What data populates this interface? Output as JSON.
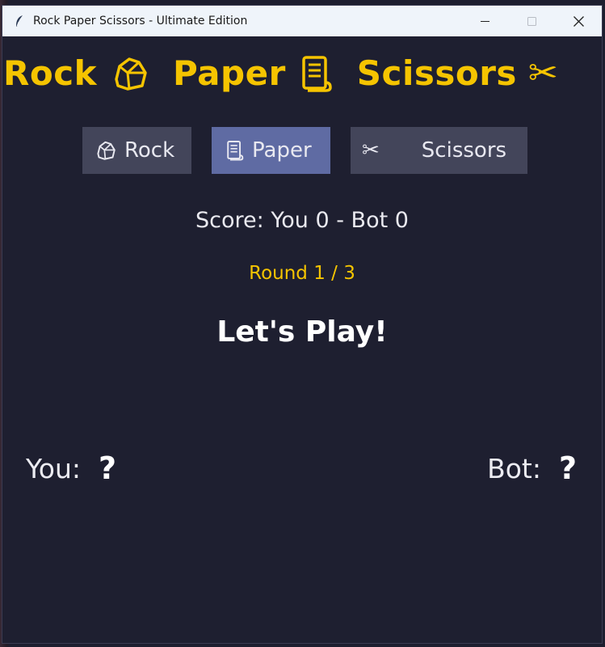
{
  "window": {
    "title": "Rock Paper Scissors - Ultimate Edition",
    "controls": {
      "minimize": "—",
      "maximize": "☐",
      "close": "✕"
    }
  },
  "header": {
    "words": [
      "Rock",
      "Paper",
      "Scissors"
    ],
    "icons": [
      "rock-icon",
      "paper-scroll-icon",
      "scissors-icon"
    ],
    "color": "#f5c400"
  },
  "choices": [
    {
      "label": "Rock",
      "icon": "rock-icon",
      "selected": false
    },
    {
      "label": "Paper",
      "icon": "paper-scroll-icon",
      "selected": true
    },
    {
      "label": "Scissors",
      "icon": "scissors-icon",
      "selected": false
    }
  ],
  "scissors_glyph": "✂",
  "score_text": "Score: You 0 - Bot 0",
  "round_text": "Round 1 / 3",
  "status_text": "Let's Play!",
  "players": {
    "you_label": "You:",
    "you_choice": "❔",
    "bot_label": "Bot:",
    "bot_choice": "❔"
  },
  "colors": {
    "background": "#1e1f30",
    "accent": "#f5c400",
    "button": "#43455a",
    "button_selected": "#5f6ba3"
  }
}
